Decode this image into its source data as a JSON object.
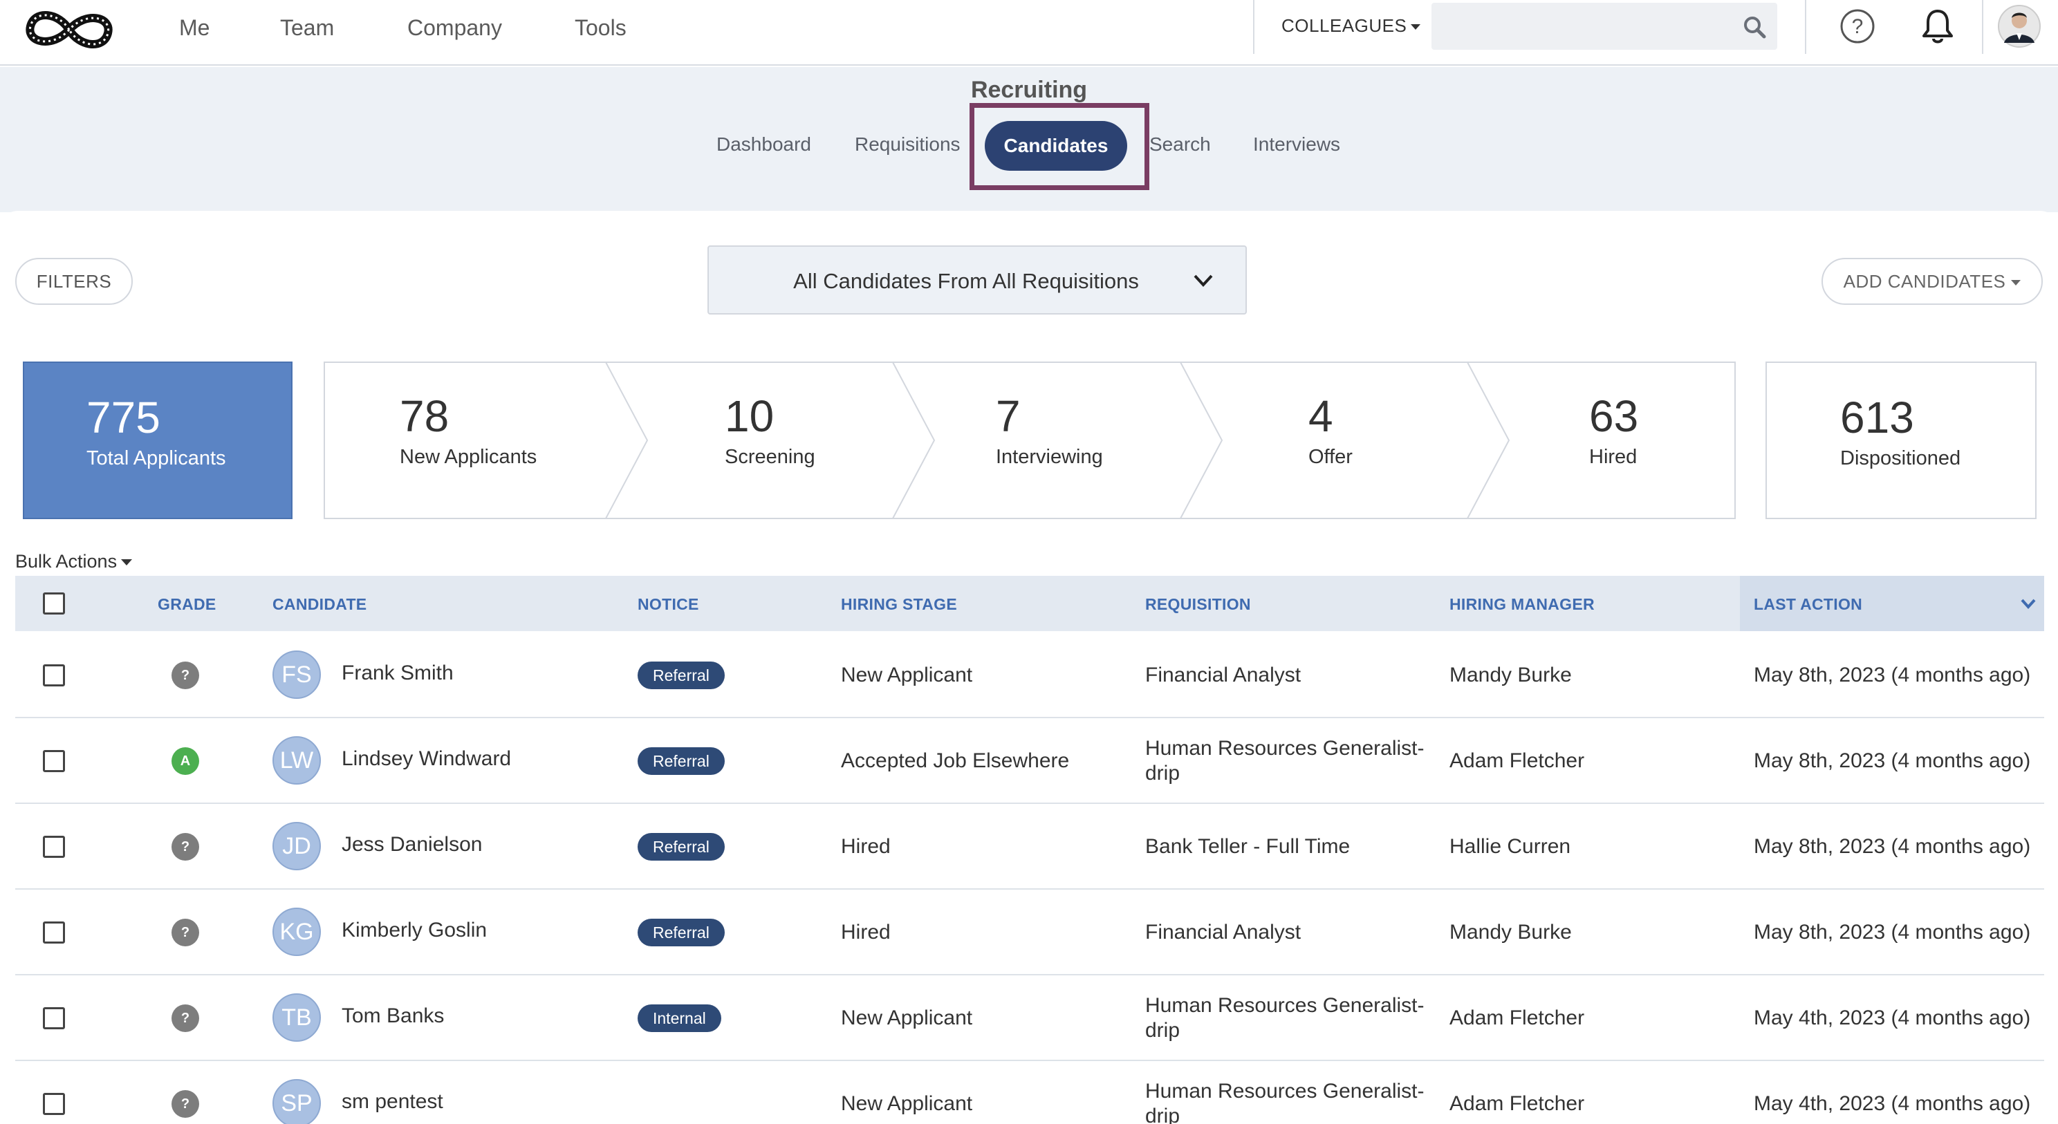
{
  "nav": {
    "links": [
      "Me",
      "Team",
      "Company",
      "Tools"
    ],
    "colleagues_label": "COLLEAGUES",
    "search_placeholder": ""
  },
  "header": {
    "section_title": "Recruiting",
    "tabs": [
      "Dashboard",
      "Requisitions",
      "Candidates",
      "Search",
      "Interviews"
    ],
    "active_tab": "Candidates"
  },
  "toolbar": {
    "filters_label": "FILTERS",
    "requisition_filter": "All Candidates From All Requisitions",
    "add_candidates_label": "ADD CANDIDATES"
  },
  "stats": {
    "total": {
      "value": "775",
      "label": "Total Applicants"
    },
    "stages": [
      {
        "value": "78",
        "label": "New Applicants"
      },
      {
        "value": "10",
        "label": "Screening"
      },
      {
        "value": "7",
        "label": "Interviewing"
      },
      {
        "value": "4",
        "label": "Offer"
      },
      {
        "value": "63",
        "label": "Hired"
      }
    ],
    "dispositioned": {
      "value": "613",
      "label": "Dispositioned"
    }
  },
  "table": {
    "bulk_actions_label": "Bulk Actions",
    "columns": [
      "GRADE",
      "CANDIDATE",
      "NOTICE",
      "HIRING STAGE",
      "REQUISITION",
      "HIRING MANAGER",
      "LAST ACTION"
    ],
    "rows": [
      {
        "grade": "?",
        "initials": "FS",
        "name": "Frank Smith",
        "notice": "Referral",
        "stage": "New Applicant",
        "requisition": "Financial Analyst",
        "manager": "Mandy Burke",
        "last_action": "May 8th, 2023 (4 months ago)"
      },
      {
        "grade": "A",
        "initials": "LW",
        "name": "Lindsey Windward",
        "notice": "Referral",
        "stage": "Accepted Job Elsewhere",
        "requisition": "Human Resources Generalist-drip",
        "manager": "Adam Fletcher",
        "last_action": "May 8th, 2023 (4 months ago)"
      },
      {
        "grade": "?",
        "initials": "JD",
        "name": "Jess Danielson",
        "notice": "Referral",
        "stage": "Hired",
        "requisition": "Bank Teller - Full Time",
        "manager": "Hallie Curren",
        "last_action": "May 8th, 2023 (4 months ago)"
      },
      {
        "grade": "?",
        "initials": "KG",
        "name": "Kimberly Goslin",
        "notice": "Referral",
        "stage": "Hired",
        "requisition": "Financial Analyst",
        "manager": "Mandy Burke",
        "last_action": "May 8th, 2023 (4 months ago)"
      },
      {
        "grade": "?",
        "initials": "TB",
        "name": "Tom Banks",
        "notice": "Internal",
        "stage": "New Applicant",
        "requisition": "Human Resources Generalist-drip",
        "manager": "Adam Fletcher",
        "last_action": "May 4th, 2023 (4 months ago)"
      },
      {
        "grade": "?",
        "initials": "SP",
        "name": "sm pentest",
        "notice": "",
        "stage": "New Applicant",
        "requisition": "Human Resources Generalist-drip",
        "manager": "Adam Fletcher",
        "last_action": "May 4th, 2023 (4 months ago)"
      }
    ]
  },
  "colors": {
    "brand_navy": "#2c4272",
    "total_tile": "#5b84c4",
    "header_blue": "#3f6bb0",
    "grade_unknown": "#7d7d7d",
    "grade_a": "#4caf50",
    "highlight": "#7a3d63"
  }
}
